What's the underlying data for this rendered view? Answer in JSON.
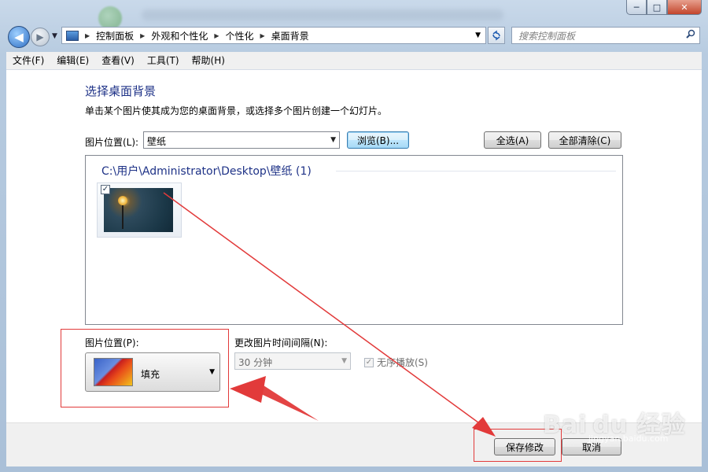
{
  "window": {
    "controls": {
      "minimize": "─",
      "maximize": "□",
      "close": "✕"
    }
  },
  "nav": {
    "back": "◀",
    "forward": "▶",
    "breadcrumb": [
      "控制面板",
      "外观和个性化",
      "个性化",
      "桌面背景"
    ],
    "search_placeholder": "搜索控制面板"
  },
  "menu": [
    "文件(F)",
    "编辑(E)",
    "查看(V)",
    "工具(T)",
    "帮助(H)"
  ],
  "page": {
    "title": "选择桌面背景",
    "description": "单击某个图片使其成为您的桌面背景，或选择多个图片创建一个幻灯片。",
    "location_label": "图片位置(L):",
    "location_value": "壁纸",
    "browse_button": "浏览(B)...",
    "select_all_button": "全选(A)",
    "clear_all_button": "全部清除(C)"
  },
  "gallery": {
    "group_header": "C:\\用户\\Administrator\\Desktop\\壁纸 (1)",
    "items": [
      {
        "checked": true,
        "check_glyph": "✓"
      }
    ]
  },
  "options": {
    "position_label": "图片位置(P):",
    "position_value": "填充",
    "interval_label": "更改图片时间间隔(N):",
    "interval_value": "30 分钟",
    "shuffle_label": "无序播放(S)",
    "shuffle_checked": true,
    "check_glyph": "✓"
  },
  "footer": {
    "save_button": "保存修改",
    "cancel_button": "取消"
  },
  "watermark": {
    "brand": "Bai du 经验",
    "url": "jingyan.baidu.com"
  },
  "colors": {
    "annotation": "#e23a3a",
    "heading": "#1e3287"
  }
}
